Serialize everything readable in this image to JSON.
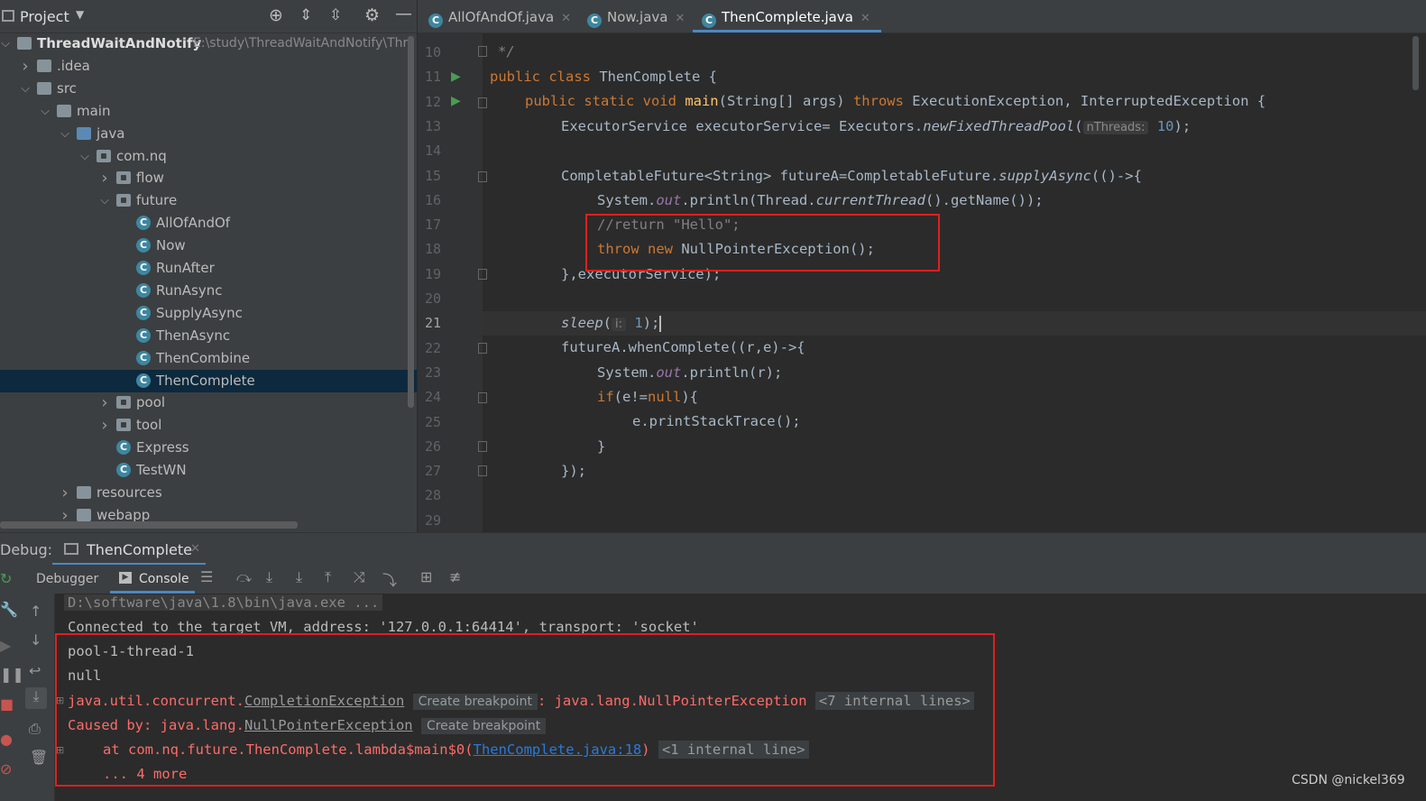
{
  "project_panel": {
    "title": "Project",
    "tree": [
      {
        "label": "ThreadWaitAndNotify",
        "path": "E:\\study\\ThreadWaitAndNotify\\Thr",
        "kind": "module"
      },
      {
        "label": ".idea",
        "kind": "folder"
      },
      {
        "label": "src",
        "kind": "folder"
      },
      {
        "label": "main",
        "kind": "folder"
      },
      {
        "label": "java",
        "kind": "src-folder"
      },
      {
        "label": "com.nq",
        "kind": "package"
      },
      {
        "label": "flow",
        "kind": "package"
      },
      {
        "label": "future",
        "kind": "package"
      },
      {
        "label": "AllOfAndOf",
        "kind": "class"
      },
      {
        "label": "Now",
        "kind": "class"
      },
      {
        "label": "RunAfter",
        "kind": "class"
      },
      {
        "label": "RunAsync",
        "kind": "class"
      },
      {
        "label": "SupplyAsync",
        "kind": "class"
      },
      {
        "label": "ThenAsync",
        "kind": "class"
      },
      {
        "label": "ThenCombine",
        "kind": "class"
      },
      {
        "label": "ThenComplete",
        "kind": "class",
        "selected": true
      },
      {
        "label": "pool",
        "kind": "package"
      },
      {
        "label": "tool",
        "kind": "package"
      },
      {
        "label": "Express",
        "kind": "class"
      },
      {
        "label": "TestWN",
        "kind": "class"
      },
      {
        "label": "resources",
        "kind": "folder"
      },
      {
        "label": "webapp",
        "kind": "folder"
      }
    ]
  },
  "editor": {
    "tabs": [
      {
        "label": "AllOfAndOf.java"
      },
      {
        "label": "Now.java"
      },
      {
        "label": "ThenComplete.java",
        "active": true
      }
    ],
    "line_numbers": [
      "10",
      "11",
      "12",
      "13",
      "14",
      "15",
      "16",
      "17",
      "18",
      "19",
      "20",
      "21",
      "22",
      "23",
      "24",
      "25",
      "26",
      "27",
      "28",
      "29"
    ],
    "code": {
      "l10": "*/",
      "l11_kw": "public class ",
      "l11_name": "ThenComplete {",
      "l12_kw": "public static void ",
      "l12_fn": "main",
      "l12_a": "(String[] args) ",
      "l12_kw2": "throws ",
      "l12_b": "ExecutionException, InterruptedException {",
      "l13_a": "ExecutorService executorService= Executors.",
      "l13_it": "newFixedThreadPool",
      "l13_b": "(",
      "l13_hint": "nThreads:",
      "l13_num": "10",
      "l13_c": ");",
      "l15_a": "CompletableFuture<String> futureA=CompletableFuture.",
      "l15_it": "supplyAsync",
      "l15_b": "(()->{",
      "l16_a": "System.",
      "l16_st": "out",
      "l16_b": ".println(Thread.",
      "l16_it": "currentThread",
      "l16_c": "().getName());",
      "l17": "//return \"Hello\";",
      "l18_kw": "throw new ",
      "l18_b": "NullPointerException();",
      "l19": "},executorService);",
      "l21_it": "sleep",
      "l21_a": "(",
      "l21_hint": "i:",
      "l21_num": "1",
      "l21_b": ");",
      "l22": "futureA.whenComplete((r,e)->{",
      "l23_a": "System.",
      "l23_st": "out",
      "l23_b": ".println(r);",
      "l24_kw": "if",
      "l24_a": "(e!=",
      "l24_kw2": "null",
      "l24_b": "){",
      "l25": "e.printStackTrace();",
      "l26": "}",
      "l27": "});"
    }
  },
  "debug": {
    "label": "Debug:",
    "session_tab": "ThenComplete",
    "debugger_tab": "Debugger",
    "console_tab": "Console",
    "console": {
      "cmd": "D:\\software\\java\\1.8\\bin\\java.exe ...",
      "connected": "Connected to the target VM, address: '127.0.0.1:64414', transport: 'socket'",
      "out1": "pool-1-thread-1",
      "out2": "null",
      "ex_prefix": "java.util.concurrent.",
      "ex_class": "CompletionException",
      "create_bp": "Create breakpoint",
      "ex_msg": ": java.lang.NullPointerException",
      "internal7": "<7 internal lines>",
      "caused_prefix": "Caused by: java.lang.",
      "caused_class": "NullPointerException",
      "at_prefix": "at com.nq.future.ThenComplete.lambda$main$0(",
      "at_link": "ThenComplete.java:18",
      "at_suffix": ")",
      "internal1": "<1 internal line>",
      "more": "... 4 more"
    }
  },
  "watermark": "CSDN @nickel369",
  "colors": {
    "highlight_box": "#e31e1e",
    "selection": "#0d293e",
    "accent": "#4a88c7"
  }
}
